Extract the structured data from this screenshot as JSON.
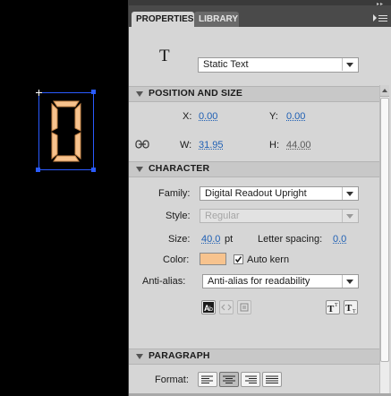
{
  "stage": {
    "glyph_text": "0"
  },
  "tabs": [
    {
      "label": "PROPERTIES",
      "active": true
    },
    {
      "label": "LIBRARY",
      "active": false
    }
  ],
  "tool": {
    "icon_label": "T",
    "text_type": "Static Text"
  },
  "position_size": {
    "title": "POSITION AND SIZE",
    "x_label": "X:",
    "x_value": "0.00",
    "y_label": "Y:",
    "y_value": "0.00",
    "w_label": "W:",
    "w_value": "31.95",
    "h_label": "H:",
    "h_value": "44.00"
  },
  "character": {
    "title": "CHARACTER",
    "family_label": "Family:",
    "family_value": "Digital Readout Upright",
    "style_label": "Style:",
    "style_value": "Regular",
    "size_label": "Size:",
    "size_value": "40.0",
    "size_unit": "pt",
    "letter_spacing_label": "Letter spacing:",
    "letter_spacing_value": "0.0",
    "color_label": "Color:",
    "color_value": "#f7c38e",
    "auto_kern_label": "Auto kern",
    "auto_kern_checked": true,
    "anti_alias_label": "Anti-alias:",
    "anti_alias_value": "Anti-alias for readability"
  },
  "paragraph": {
    "title": "PARAGRAPH",
    "format_label": "Format:",
    "selected_align": "center"
  },
  "colors": {
    "selection_blue": "#2a5bff",
    "link_blue": "#1e5fb4",
    "glyph_fill": "#f7c38e"
  }
}
